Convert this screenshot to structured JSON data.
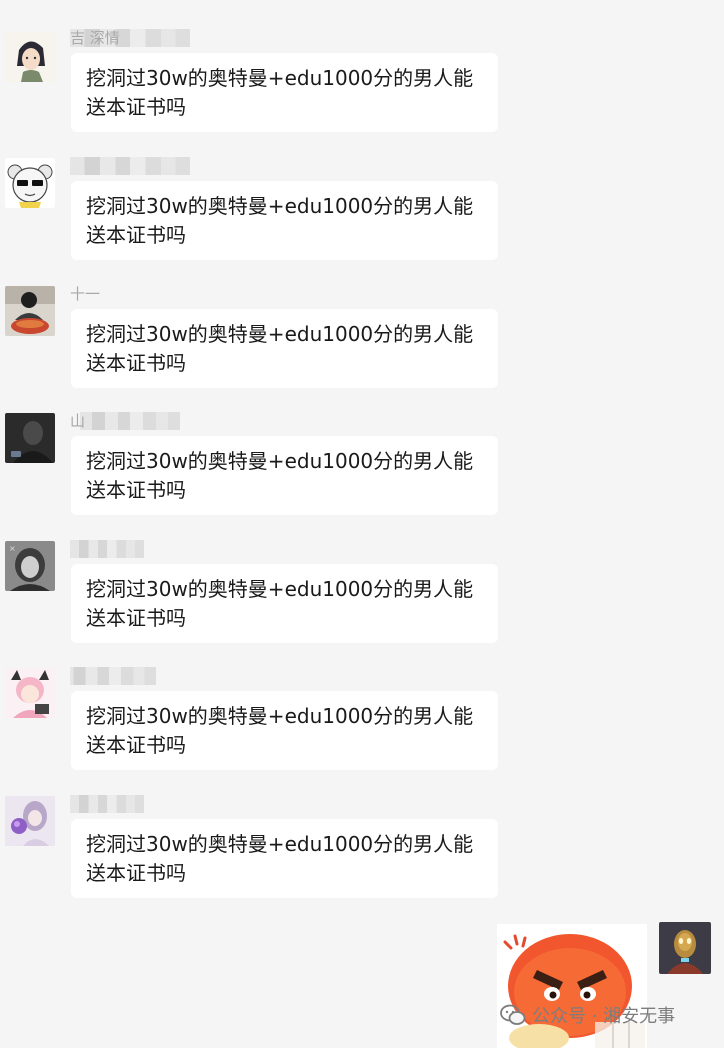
{
  "messages": [
    {
      "sender": "吉 深情",
      "text": "挖洞过30w的奥特曼+edu1000分的男人能送本证书吗"
    },
    {
      "sender": "",
      "text": "挖洞过30w的奥特曼+edu1000分的男人能送本证书吗"
    },
    {
      "sender": "十一",
      "text": "挖洞过30w的奥特曼+edu1000分的男人能送本证书吗"
    },
    {
      "sender": "山",
      "text": "挖洞过30w的奥特曼+edu1000分的男人能送本证书吗"
    },
    {
      "sender": "",
      "text": "挖洞过30w的奥特曼+edu1000分的男人能送本证书吗"
    },
    {
      "sender": "",
      "text": "挖洞过30w的奥特曼+edu1000分的男人能送本证书吗"
    },
    {
      "sender": "",
      "text": "挖洞过30w的奥特曼+edu1000分的男人能送本证书吗"
    }
  ],
  "self_message": {
    "type": "sticker",
    "sticker_icon": "angry-face-sticker"
  },
  "watermark": {
    "text": "公众号 · 湘安无事",
    "icon": "wechat-icon"
  }
}
